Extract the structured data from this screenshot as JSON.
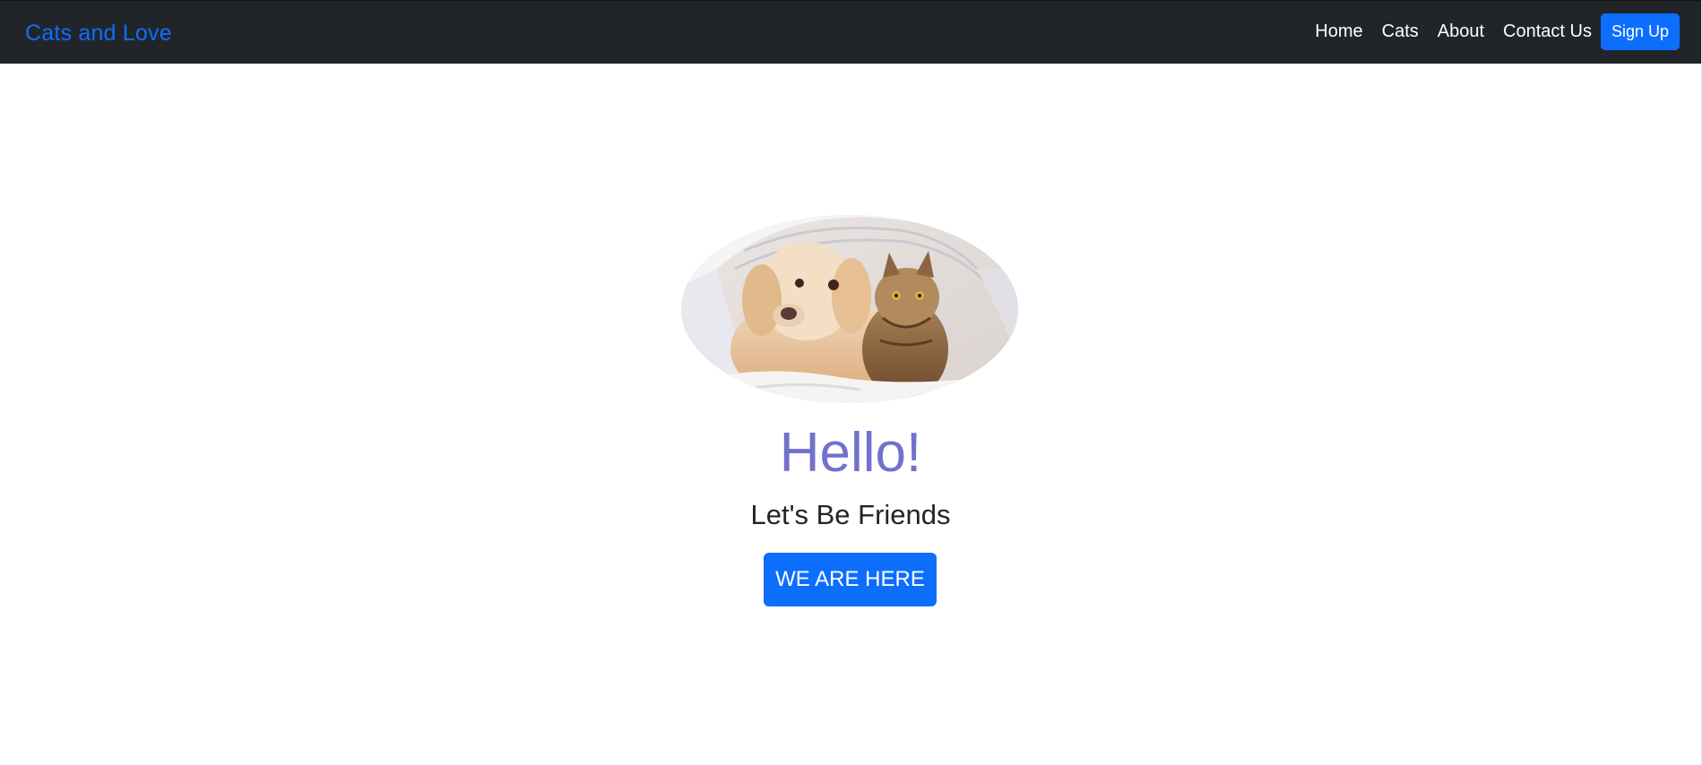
{
  "navbar": {
    "brand": "Cats and Love",
    "links": [
      "Home",
      "Cats",
      "About",
      "Contact Us"
    ],
    "signup_label": "Sign Up"
  },
  "hero": {
    "image_icon": "dog-and-cat-photo",
    "title": "Hello!",
    "subtitle": "Let's Be Friends",
    "cta_label": "WE ARE HERE"
  },
  "colors": {
    "navbar_bg": "#212529",
    "brand": "#0d6efd",
    "primary_button": "#0d6efd",
    "title": "#7171cd",
    "subtitle": "#212529"
  }
}
